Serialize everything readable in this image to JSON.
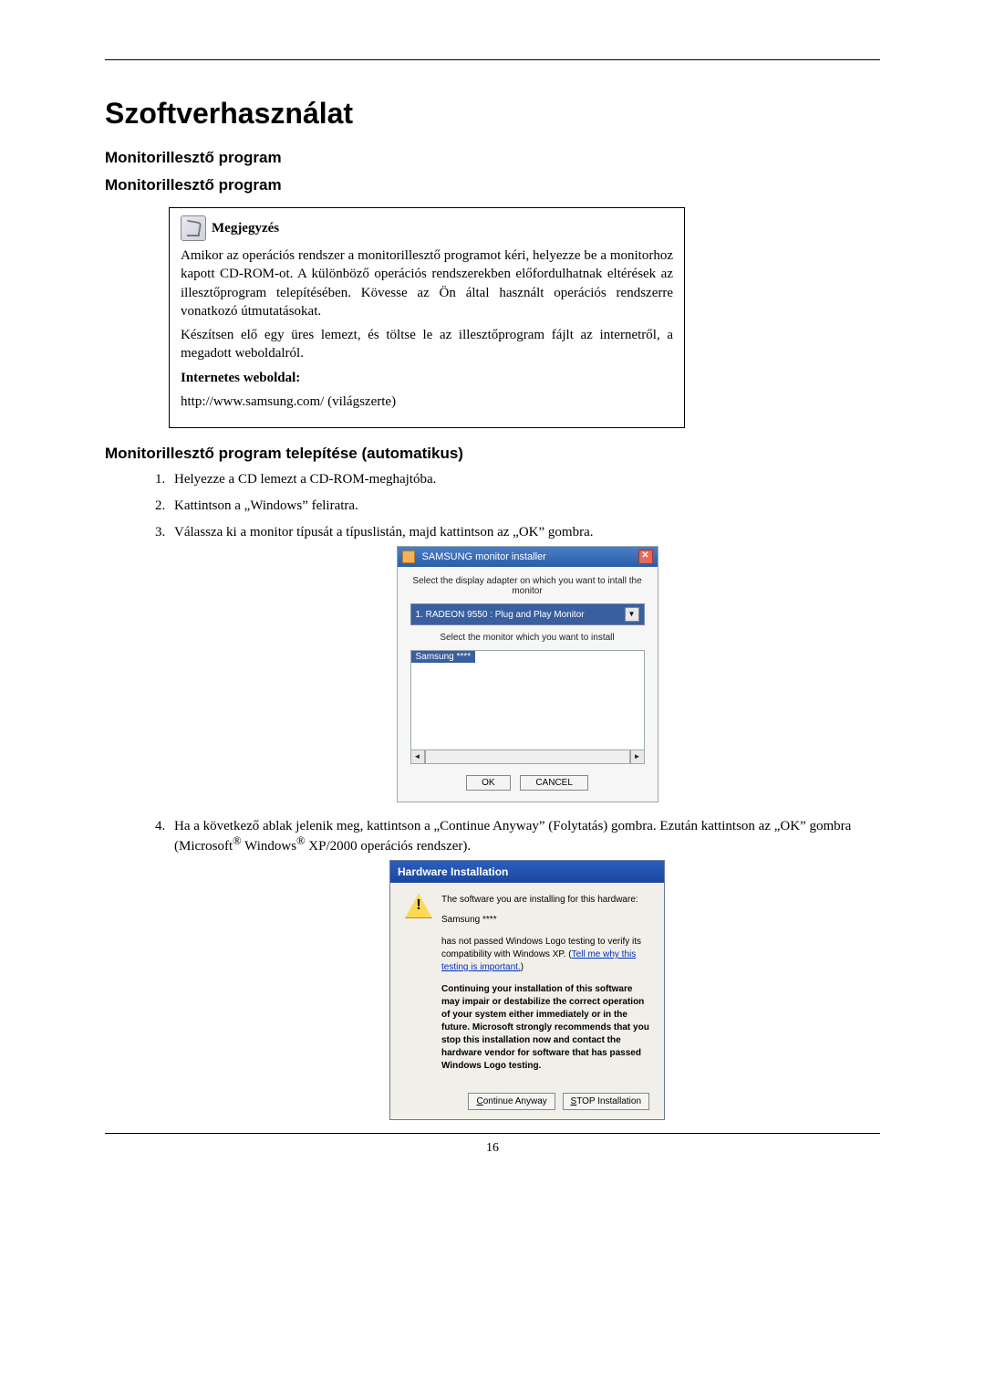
{
  "title": "Szoftverhasználat",
  "sub1": "Monitorillesztő program",
  "sub2": "Monitorillesztő program",
  "note": {
    "heading": "Megjegyzés",
    "p1": "Amikor az operációs rendszer a monitorillesztő programot kéri, helyezze be a monitorhoz kapott CD-ROM-ot. A különböző operációs rendszerekben előfordulhatnak eltérések az illesztőprogram telepítésében. Kövesse az Ön által használt operációs rendszerre vonatkozó útmutatásokat.",
    "p2": "Készítsen elő egy üres lemezt, és töltse le az illesztőprogram fájlt az internetről, a megadott weboldalról.",
    "bold": "Internetes weboldal:",
    "url": "http://www.samsung.com/ (világszerte)"
  },
  "sub3": "Monitorillesztő program telepítése (automatikus)",
  "steps": {
    "1": "Helyezze a CD lemezt a CD-ROM-meghajtóba.",
    "2": "Kattintson a „Windows” feliratra.",
    "3": "Válassza ki a monitor típusát a típuslistán, majd kattintson az „OK” gombra.",
    "4a": "Ha a következő ablak jelenik meg, kattintson a „Continue Anyway” (Folytatás) gombra. Ezután kattintson az „OK” gombra (Microsoft",
    "4b": " Windows",
    "4c": " XP/2000 operációs rendszer)."
  },
  "shot1": {
    "title": "SAMSUNG monitor installer",
    "label1": "Select the display adapter on which you want to intall the monitor",
    "dropdown": "1. RADEON 9550 : Plug and Play Monitor",
    "label2": "Select the monitor which you want to install",
    "listitem": "Samsung ****",
    "ok": "OK",
    "cancel": "CANCEL"
  },
  "shot2": {
    "title": "Hardware Installation",
    "p1": "The software you are installing for this hardware:",
    "p2": "Samsung ****",
    "p3a": "has not passed Windows Logo testing to verify its compatibility with Windows XP. (",
    "link": "Tell me why this testing is important.",
    "p3b": ")",
    "boldp": "Continuing your installation of this software may impair or destabilize the correct operation of your system either immediately or in the future. Microsoft strongly recommends that you stop this installation now and contact the hardware vendor for software that has passed Windows Logo testing.",
    "btn1": "Continue Anyway",
    "btn2": "STOP Installation",
    "btn1_u": "C",
    "btn2_u": "S"
  },
  "page_num": "16"
}
